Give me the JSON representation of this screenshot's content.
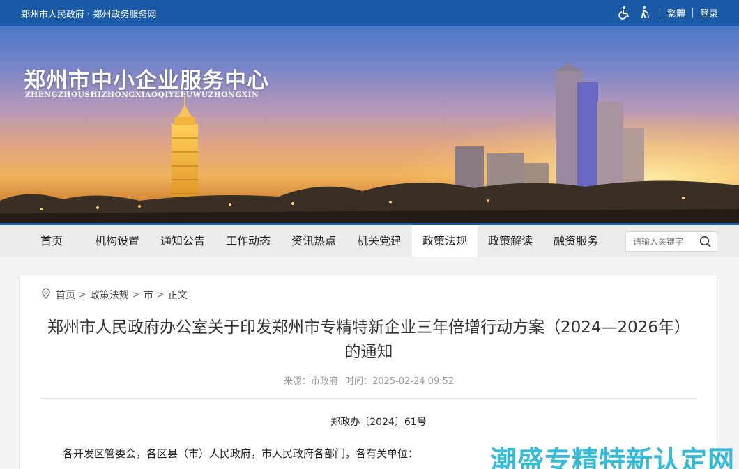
{
  "topbar": {
    "site_links": "郑州市人民政府 · 郑州政务服务网",
    "accessibility_icons": [
      "wheelchair-icon",
      "elderly-icon"
    ],
    "traditional": "繁體",
    "login": "登录"
  },
  "banner": {
    "title": "郑州市中小企业服务中心",
    "subtitle": "ZHENGZHOUSHIZHONGXIAOQIYEFUWUZHONGXIN"
  },
  "nav": {
    "items": [
      {
        "label": "首页"
      },
      {
        "label": "机构设置"
      },
      {
        "label": "通知公告"
      },
      {
        "label": "工作动态"
      },
      {
        "label": "资讯热点"
      },
      {
        "label": "机关党建"
      },
      {
        "label": "政策法规",
        "active": true
      },
      {
        "label": "政策解读"
      },
      {
        "label": "融资服务"
      }
    ],
    "search_placeholder": "请输入关键字"
  },
  "breadcrumb": [
    "首页",
    "政策法规",
    "市",
    "正文"
  ],
  "article": {
    "title_line1": "郑州市人民政府办公室关于印发郑州市专精特新企业三年倍增行动方案（2024—2026年）",
    "title_line2": "的通知",
    "source": "来源：市政府",
    "time": "时间：2025-02-24 09:52",
    "doc_number": "郑政办〔2024〕61号",
    "salutation": "各开发区管委会，各区县（市）人民政府，市人民政府各部门，各有关单位："
  },
  "watermark": "潮盛专精特新认定网",
  "colors": {
    "brand_blue": "#1b5aa6",
    "nav_bg": "#ececec",
    "watermark": "#25b6d4"
  }
}
